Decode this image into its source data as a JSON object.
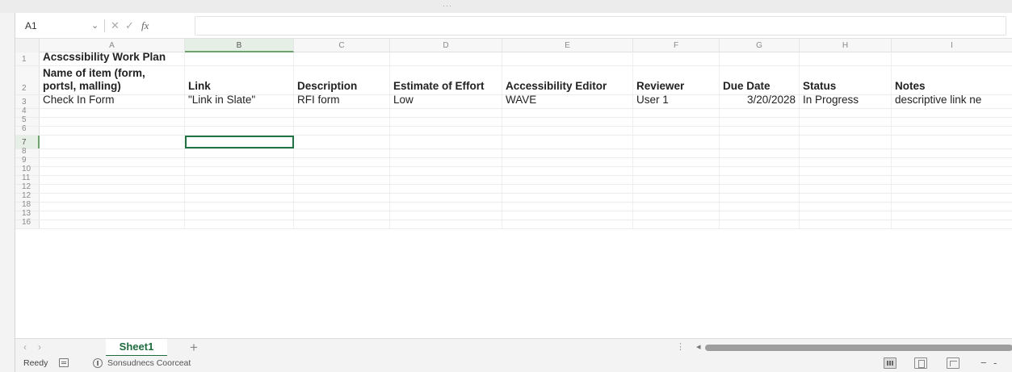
{
  "formula_bar": {
    "name_box": "A1",
    "cancel_glyph": "✕",
    "enter_glyph": "✓",
    "fx_glyph": "fx",
    "content": ""
  },
  "columns": [
    "A",
    "B",
    "C",
    "D",
    "E",
    "F",
    "G",
    "H",
    "I"
  ],
  "rows": [
    {
      "num": "1",
      "cells": [
        "Acscssibility Work Plan",
        "",
        "",
        "",
        "",
        "",
        "",
        "",
        ""
      ]
    },
    {
      "num": "2",
      "cells": [
        "Name of item (form, portsl, malling)",
        "Link",
        "Description",
        "Estimate of Effort",
        "Accessibility Editor",
        "Reviewer",
        "Due Date",
        "Status",
        "Notes"
      ]
    },
    {
      "num": "3",
      "cells": [
        "Check In Form",
        "\"Link in Slate\"",
        "RFI form",
        "Low",
        "WAVE",
        "User 1",
        "3/20/2028",
        "In Progress",
        "descriptive link ne"
      ]
    },
    {
      "num": "4",
      "cells": [
        "",
        "",
        "",
        "",
        "",
        "",
        "",
        "",
        ""
      ]
    },
    {
      "num": "5",
      "cells": [
        "",
        "",
        "",
        "",
        "",
        "",
        "",
        "",
        ""
      ]
    },
    {
      "num": "6",
      "cells": [
        "",
        "",
        "",
        "",
        "",
        "",
        "",
        "",
        ""
      ]
    },
    {
      "num": "7",
      "cells": [
        "",
        "",
        "",
        "",
        "",
        "",
        "",
        "",
        ""
      ]
    },
    {
      "num": "8",
      "cells": [
        "",
        "",
        "",
        "",
        "",
        "",
        "",
        "",
        ""
      ]
    },
    {
      "num": "9",
      "cells": [
        "",
        "",
        "",
        "",
        "",
        "",
        "",
        "",
        ""
      ]
    },
    {
      "num": "10",
      "cells": [
        "",
        "",
        "",
        "",
        "",
        "",
        "",
        "",
        ""
      ]
    },
    {
      "num": "11",
      "cells": [
        "",
        "",
        "",
        "",
        "",
        "",
        "",
        "",
        ""
      ]
    },
    {
      "num": "12",
      "cells": [
        "",
        "",
        "",
        "",
        "",
        "",
        "",
        "",
        ""
      ]
    },
    {
      "num": "12",
      "cells": [
        "",
        "",
        "",
        "",
        "",
        "",
        "",
        "",
        ""
      ]
    },
    {
      "num": "18",
      "cells": [
        "",
        "",
        "",
        "",
        "",
        "",
        "",
        "",
        ""
      ]
    },
    {
      "num": "13",
      "cells": [
        "",
        "",
        "",
        "",
        "",
        "",
        "",
        "",
        ""
      ]
    },
    {
      "num": "16",
      "cells": [
        "",
        "",
        "",
        "",
        "",
        "",
        "",
        "",
        ""
      ]
    }
  ],
  "selected_cell": {
    "row": "7",
    "column": "B"
  },
  "sheet_tabs": {
    "prev": "‹",
    "next": "›",
    "active": "Sheet1",
    "add": "+",
    "scroll_dots": "⋮",
    "scroll_left": "◂"
  },
  "status_bar": {
    "ready": "Reedy",
    "accessibility": "Sonsudnecs Coorceat",
    "zoom_minus": "−",
    "zoom_dash": "-"
  },
  "colors": {
    "selection": "#217346",
    "header_highlight": "#e6efe6",
    "sheet_tab_text": "#1e6b3e"
  },
  "icons": {
    "namebox_dropdown": "chevron-down-icon",
    "status_sheet": "sheet-icon",
    "accessibility": "accessibility-icon",
    "view_normal": "normal-view-icon",
    "view_layout": "page-layout-icon",
    "view_break": "page-break-icon"
  }
}
